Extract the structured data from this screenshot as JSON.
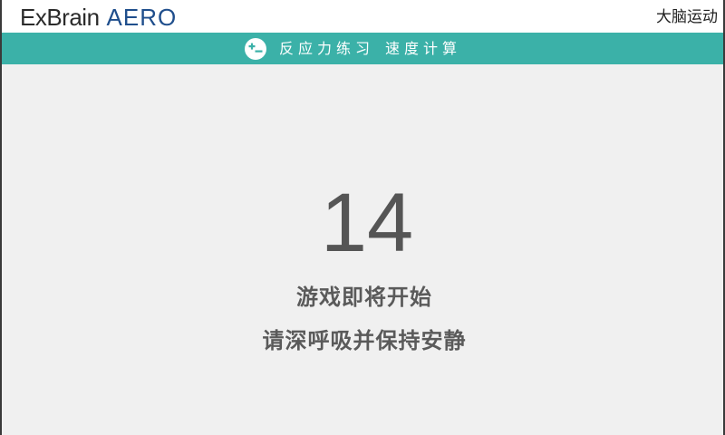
{
  "header": {
    "logo_prefix": "ExBrain",
    "logo_suffix": "AERO",
    "app_name": "大脑运动"
  },
  "subheader": {
    "icon": "plus-minus-icon",
    "category": "反应力练习",
    "exercise": "速度计算"
  },
  "main": {
    "countdown": "14",
    "message_line1": "游戏即将开始",
    "message_line2": "请深呼吸并保持安静"
  },
  "colors": {
    "accent": "#3bb1a8",
    "logo_blue": "#1f4e8c",
    "text_gray": "#555555",
    "background": "#f0f0f0"
  }
}
